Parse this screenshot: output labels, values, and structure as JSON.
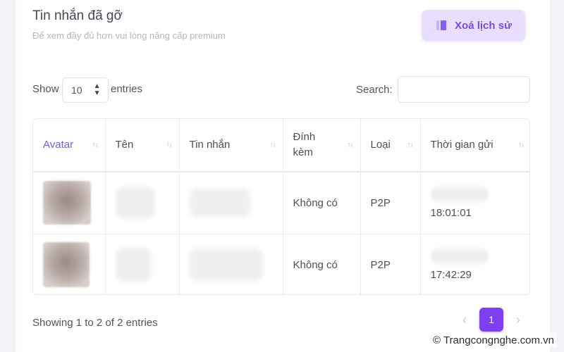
{
  "header": {
    "title": "Tin nhắn đã gỡ",
    "subtitle": "Để xem đầy đủ hơn vui lòng nâng cấp premium",
    "clear_button": "Xoá lịch sử"
  },
  "controls": {
    "show_label": "Show",
    "entries_value": "10",
    "entries_label": "entries",
    "search_label": "Search:",
    "search_value": ""
  },
  "table": {
    "columns": [
      "Avatar",
      "Tên",
      "Tin nhắn",
      "Đính kèm",
      "Loại",
      "Thời gian gửi"
    ],
    "rows": [
      {
        "attachment": "Không có",
        "type": "P2P",
        "time": "18:01:01"
      },
      {
        "attachment": "Không có",
        "type": "P2P",
        "time": "17:42:29"
      }
    ]
  },
  "footer": {
    "info": "Showing 1 to 2 of 2 entries",
    "current_page": "1",
    "prev": "‹",
    "next": "›"
  },
  "watermark": "© Trangcongnghe.com.vn",
  "colors": {
    "accent": "#7d3ff0",
    "button_bg": "#e9defd",
    "button_text": "#7b4be0"
  }
}
